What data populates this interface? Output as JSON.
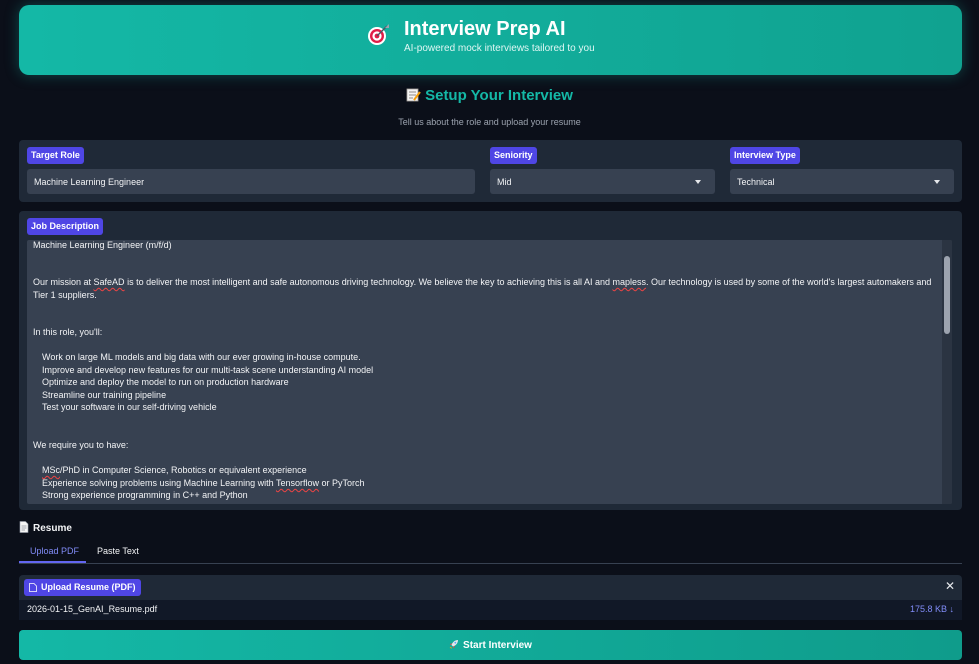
{
  "header": {
    "icon": "target-icon",
    "title": "Interview Prep AI",
    "subtitle": "AI-powered mock interviews tailored to you"
  },
  "setup": {
    "icon": "memo-icon",
    "title": "Setup Your Interview",
    "subtitle": "Tell us about the role and upload your resume"
  },
  "form": {
    "target_role": {
      "label": "Target Role",
      "value": "Machine Learning Engineer"
    },
    "seniority": {
      "label": "Seniority",
      "value": "Mid"
    },
    "interview_type": {
      "label": "Interview Type",
      "value": "Technical"
    }
  },
  "job_description": {
    "label": "Job Description",
    "line_0": "Machine Learning Engineer (m/f/d)",
    "line_1_a": "Our mission at ",
    "line_1_b": "SafeAD",
    "line_1_c": " is to deliver the most intelligent and safe autonomous driving technology. We believe the key to achieving this is all AI and ",
    "line_1_d": "mapless",
    "line_1_e": ". Our technology is used by some of the world's largest automakers and",
    "line_2": "Tier 1 suppliers.",
    "line_3": "In this role, you'll:",
    "line_4": "Work on large ML models and big data with our ever growing in-house compute.",
    "line_5": "Improve and develop new features for our multi-task scene understanding AI model",
    "line_6": "Optimize and deploy the model to run on production hardware",
    "line_7": "Streamline our training pipeline",
    "line_8": "Test your software in our self-driving vehicle",
    "line_9": "We require you to have:",
    "line_10_a": "MSc",
    "line_10_b": "/PhD in Computer Science, Robotics or equivalent experience",
    "line_11_a": "Experience solving problems using Machine Learning with ",
    "line_11_b": "Tensorflow",
    "line_11_c": " or PyTorch",
    "line_12": "Strong experience programming in C++ and Python"
  },
  "resume": {
    "icon": "page-icon",
    "title": "Resume",
    "tabs": [
      "Upload PDF",
      "Paste Text"
    ],
    "upload_label": "Upload Resume (PDF)",
    "file_name": "2026-01-15_GenAI_Resume.pdf",
    "file_size": "175.8 KB ↓",
    "close_symbol": "✕"
  },
  "actions": {
    "start_icon": "rocket-icon",
    "start_label": "Start Interview"
  },
  "colors": {
    "background": "#0b0f19",
    "accent_teal": "#14b8a6",
    "chip_indigo": "#4f46e5",
    "panel": "#1f2937",
    "input": "#374151"
  }
}
